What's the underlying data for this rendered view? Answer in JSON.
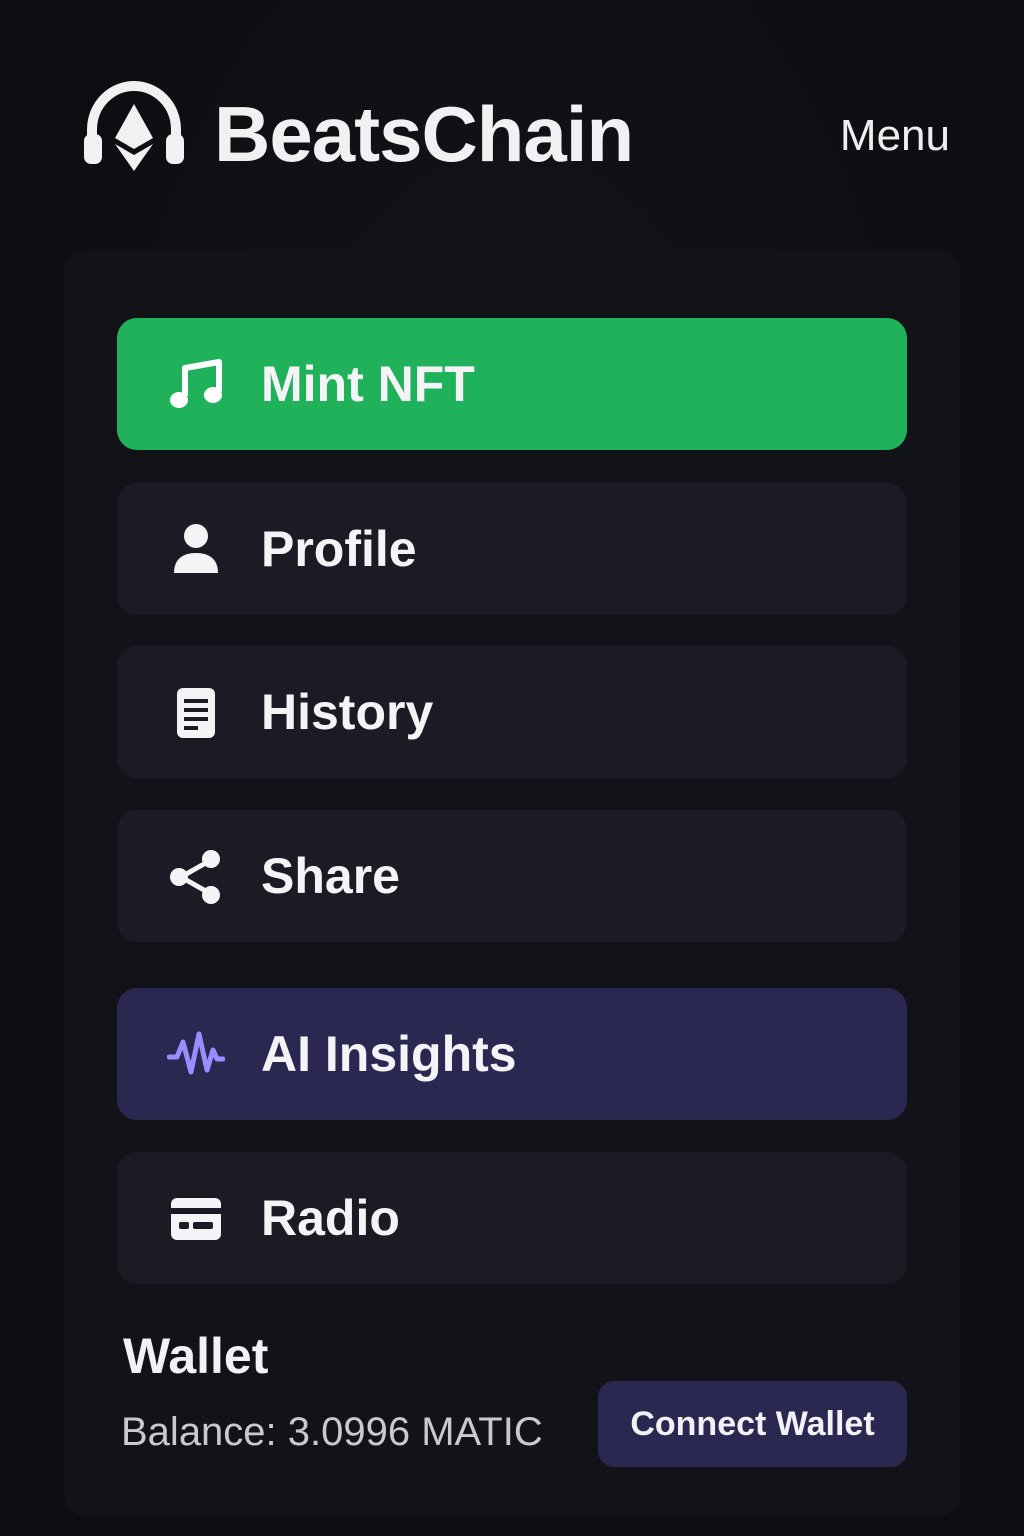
{
  "header": {
    "brand": "BeatsChain",
    "logo_icon": "headphones-ethereum-icon",
    "menu_label": "Menu"
  },
  "nav": {
    "items": [
      {
        "label": "Mint NFT",
        "icon": "music-note-icon",
        "variant": "primary"
      },
      {
        "label": "Profile",
        "icon": "user-icon",
        "variant": "default"
      },
      {
        "label": "History",
        "icon": "document-icon",
        "variant": "default"
      },
      {
        "label": "Share",
        "icon": "share-icon",
        "variant": "default"
      },
      {
        "label": "AI Insights",
        "icon": "waveform-icon",
        "variant": "accent"
      },
      {
        "label": "Radio",
        "icon": "card-icon",
        "variant": "default"
      }
    ]
  },
  "wallet": {
    "title": "Wallet",
    "balance": "Balance: 3.0996 MATIC",
    "connect_label": "Connect Wallet"
  },
  "colors": {
    "background": "#0d0e13",
    "panel": "#121318",
    "item": "#1a1b24",
    "primary": "#1fb25b",
    "accent": "#2a2850",
    "waveform": "#9b8cff"
  }
}
